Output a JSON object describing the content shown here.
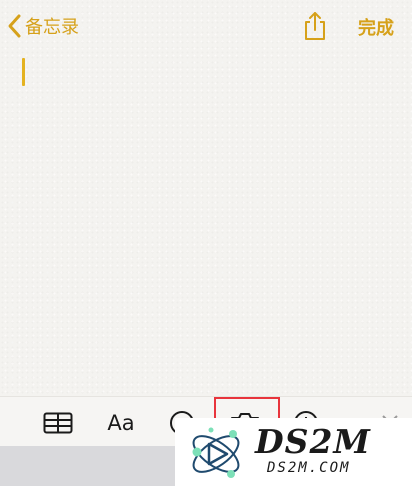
{
  "colors": {
    "accent": "#d6a11a",
    "cursor": "#e4b21f",
    "highlight_box": "#e8343c",
    "toolbar_icon": "#1a1a1a"
  },
  "nav": {
    "back_label": "备忘录",
    "back_icon": "chevron-left-icon",
    "share_icon": "share-icon",
    "done_label": "完成"
  },
  "note": {
    "content": ""
  },
  "toolbar": {
    "items": [
      {
        "name": "table",
        "icon": "table-icon"
      },
      {
        "name": "format",
        "label": "Aa",
        "icon": "format-text-icon"
      },
      {
        "name": "checklist",
        "icon": "checklist-icon"
      },
      {
        "name": "camera",
        "icon": "camera-icon",
        "highlighted": true
      },
      {
        "name": "markup",
        "icon": "markup-pen-icon"
      },
      {
        "name": "close",
        "icon": "close-icon"
      }
    ]
  },
  "watermark": {
    "title": "DS2M",
    "subtitle": "DS2M.COM"
  }
}
